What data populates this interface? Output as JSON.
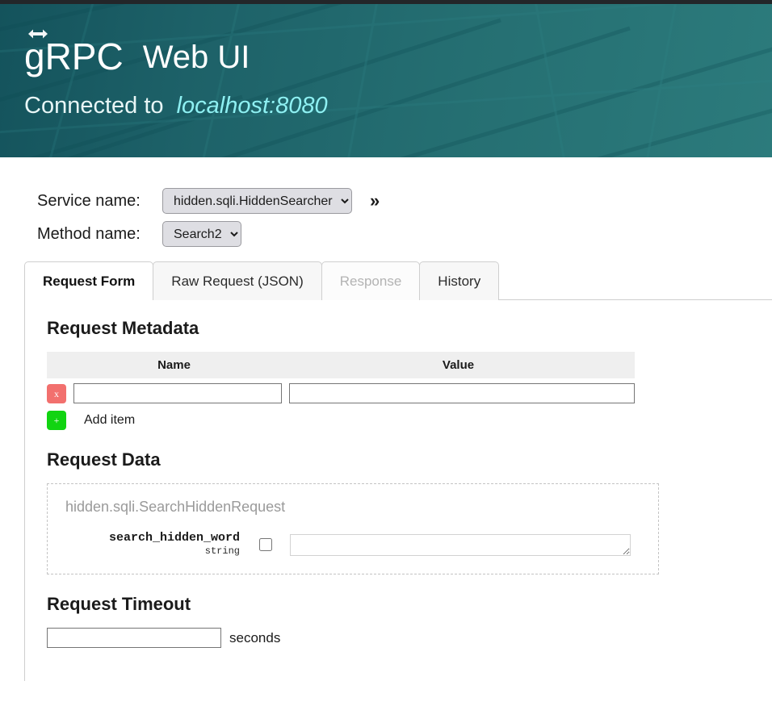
{
  "header": {
    "brand_primary": "gRPC",
    "brand_secondary": "Web UI",
    "logo_icon": "grpc-arrow-logo-icon",
    "connected_label": "Connected to",
    "connected_target": "localhost:8080",
    "banner_color": "#256f72",
    "banner_color_dark": "#14535c",
    "target_color": "#8ef0f2"
  },
  "selectors": {
    "service": {
      "label": "Service name:",
      "value": "hidden.sqli.HiddenSearcher",
      "options": [
        "hidden.sqli.HiddenSearcher"
      ],
      "chevron_icon": "chevron-down-icon"
    },
    "method": {
      "label": "Method name:",
      "value": "Search2",
      "options": [
        "Search2"
      ],
      "chevron_icon": "chevron-down-icon"
    },
    "expand_icon": "double-chevron-right-icon",
    "expand_label": "»"
  },
  "tabs": [
    {
      "label": "Request Form",
      "state": "active"
    },
    {
      "label": "Raw Request (JSON)",
      "state": "normal"
    },
    {
      "label": "Response",
      "state": "disabled"
    },
    {
      "label": "History",
      "state": "normal"
    }
  ],
  "metadata": {
    "title": "Request Metadata",
    "columns": [
      "Name",
      "Value"
    ],
    "rows": [
      {
        "remove_label": "x",
        "name_value": "",
        "name_placeholder": "",
        "value_value": "",
        "value_placeholder": ""
      }
    ],
    "add": {
      "icon_label": "+",
      "label": "Add item"
    },
    "remove_color": "#f2706e",
    "add_color": "#11d411"
  },
  "request_data": {
    "title": "Request Data",
    "message_type": "hidden.sqli.SearchHiddenRequest",
    "fields": [
      {
        "name": "search_hidden_word",
        "type": "string",
        "checked": false,
        "value": "",
        "placeholder": ""
      }
    ]
  },
  "timeout": {
    "title": "Request Timeout",
    "value": "",
    "placeholder": "",
    "unit": "seconds"
  }
}
